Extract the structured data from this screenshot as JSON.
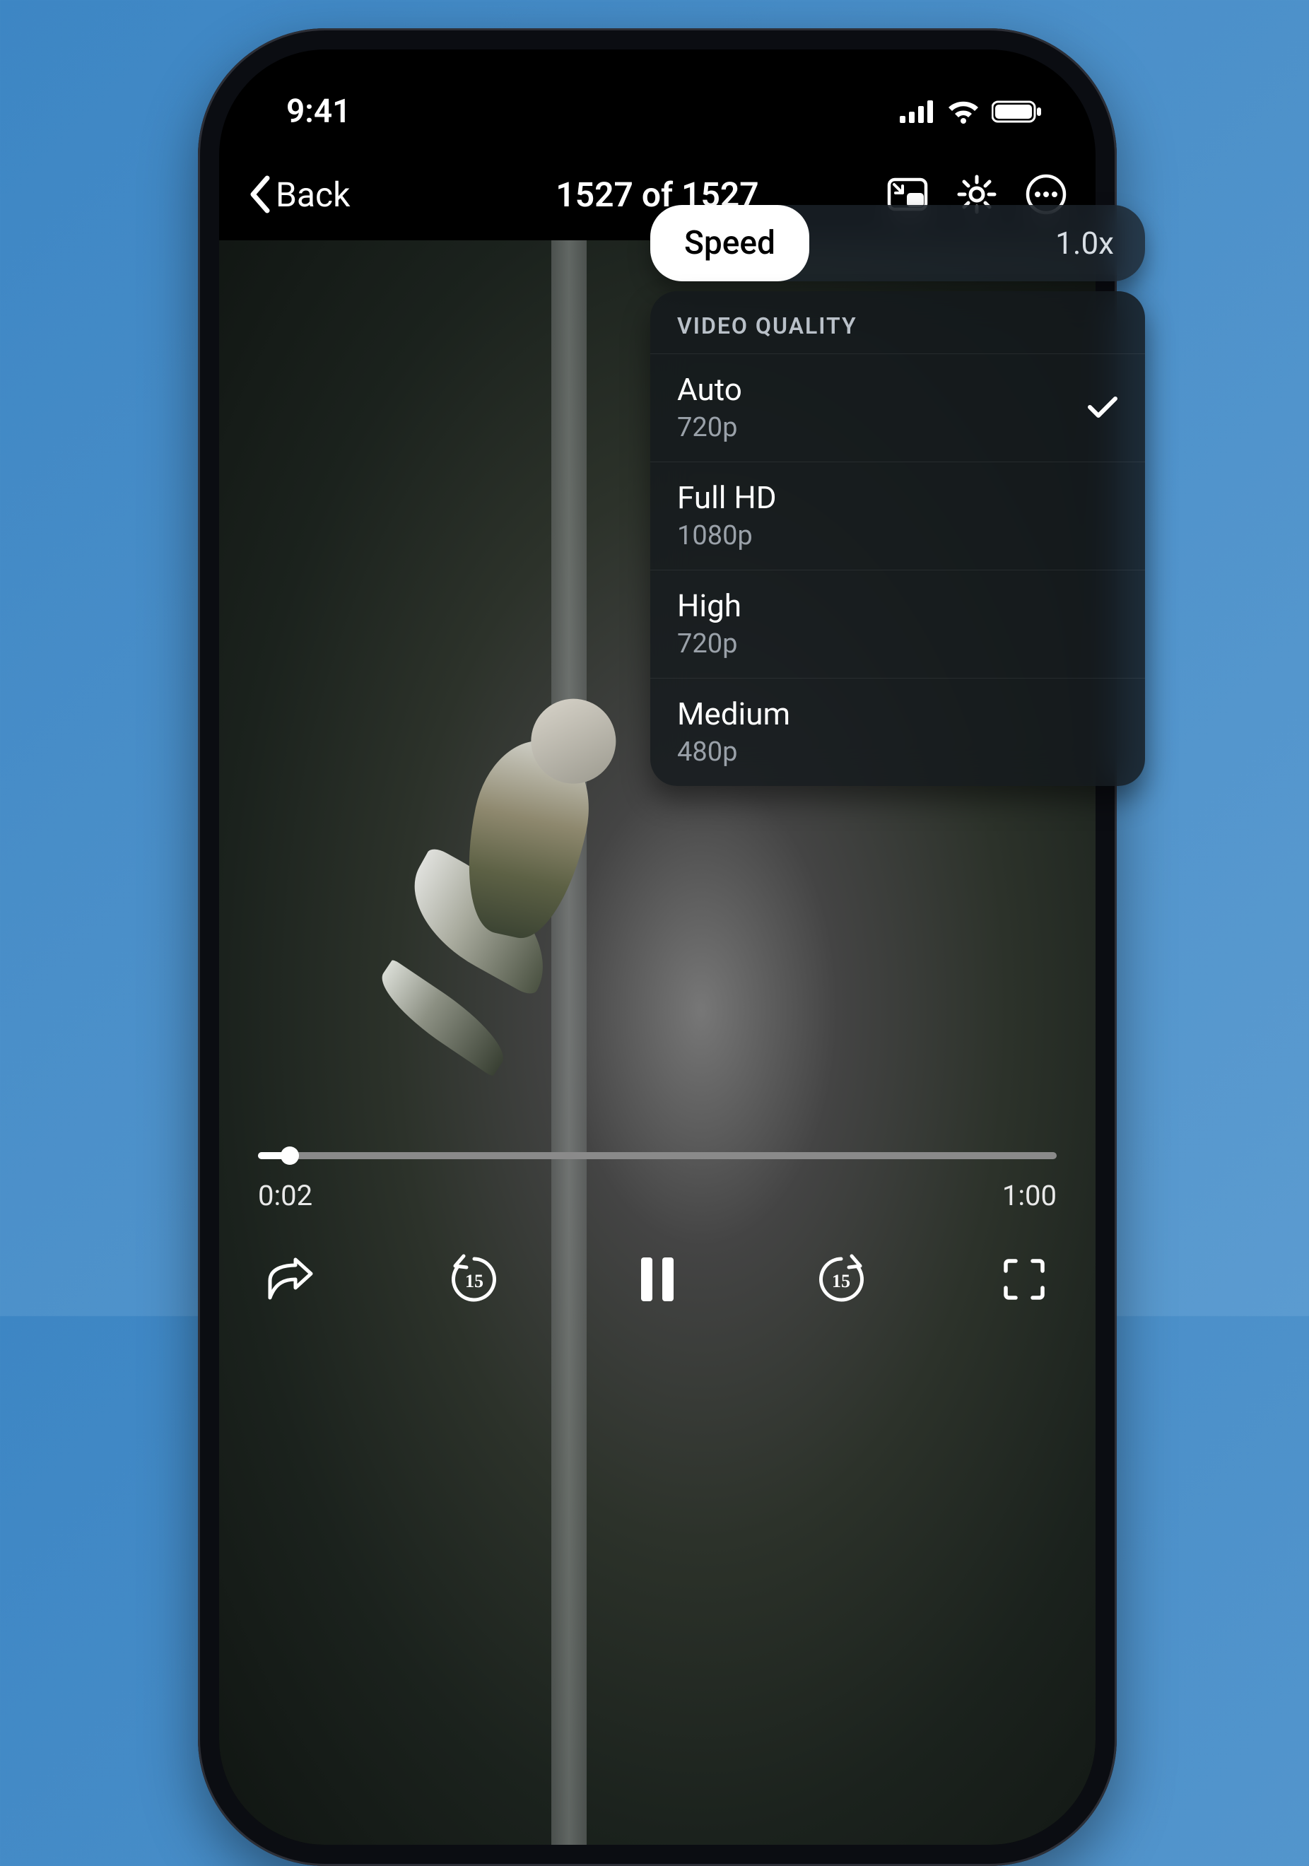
{
  "status": {
    "time": "9:41"
  },
  "nav": {
    "back_label": "Back",
    "title": "1527 of 1527"
  },
  "settings": {
    "speed_label": "Speed",
    "speed_value": "1.0x",
    "quality_header": "VIDEO QUALITY",
    "quality_options": [
      {
        "title": "Auto",
        "sub": "720p",
        "selected": true
      },
      {
        "title": "Full HD",
        "sub": "1080p",
        "selected": false
      },
      {
        "title": "High",
        "sub": "720p",
        "selected": false
      },
      {
        "title": "Medium",
        "sub": "480p",
        "selected": false
      }
    ]
  },
  "playback": {
    "current_time": "0:02",
    "duration": "1:00",
    "skip_seconds": "15"
  }
}
